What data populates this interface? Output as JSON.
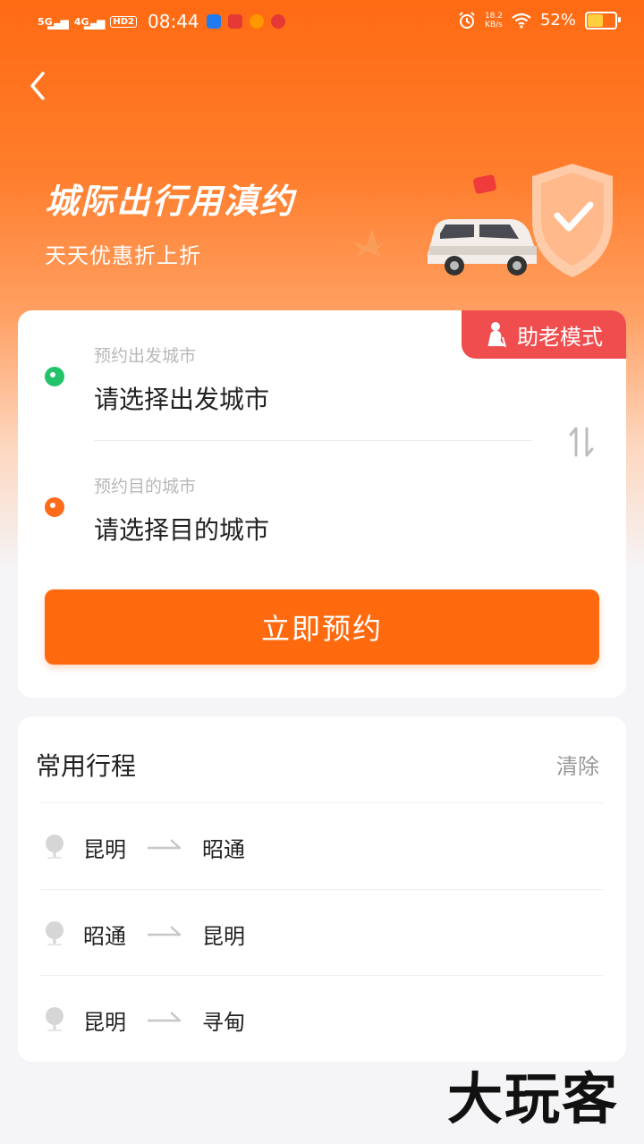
{
  "status_bar": {
    "signal1": "5G",
    "signal2": "4G",
    "hd": "HD2",
    "time": "08:44",
    "speed_value": "18.2",
    "speed_unit": "KB/s",
    "battery": "52%"
  },
  "hero": {
    "title": "城际出行用滇约",
    "subtitle": "天天优惠折上折"
  },
  "booking": {
    "elder_mode": "助老模式",
    "departure_label": "预约出发城市",
    "departure_placeholder": "请选择出发城市",
    "destination_label": "预约目的城市",
    "destination_placeholder": "请选择目的城市",
    "book_button": "立即预约"
  },
  "frequent": {
    "title": "常用行程",
    "clear": "清除",
    "trips": [
      {
        "from": "昆明",
        "to": "昭通"
      },
      {
        "from": "昭通",
        "to": "昆明"
      },
      {
        "from": "昆明",
        "to": "寻甸"
      }
    ]
  },
  "watermark": "大玩客",
  "colors": {
    "accent": "#ff6a0e",
    "elder_badge": "#f04e4e",
    "departure_dot": "#22c36b",
    "destination_dot": "#ff6b1a"
  }
}
